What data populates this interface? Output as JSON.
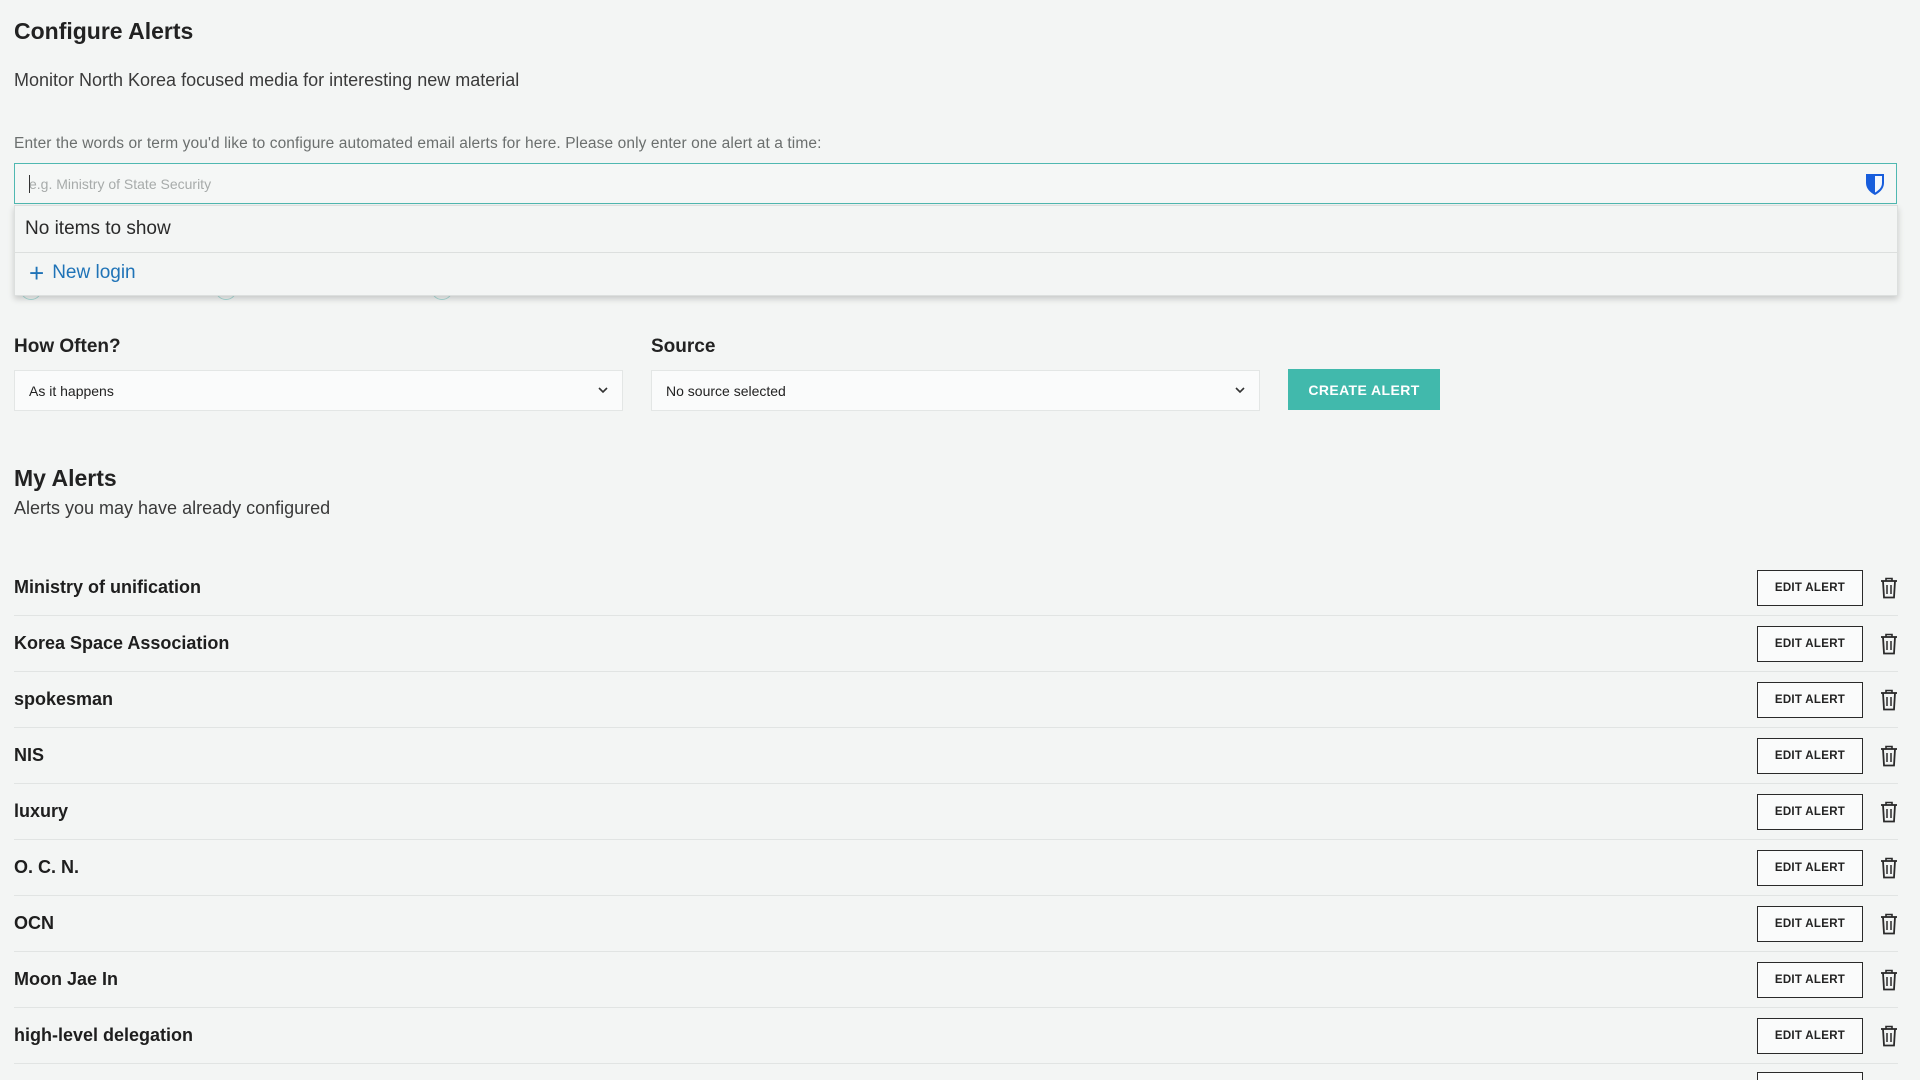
{
  "header": {
    "title": "Configure Alerts",
    "subtitle": "Monitor North Korea focused media for interesting new material"
  },
  "form": {
    "instructions": "Enter the words or term you'd like to configure automated email alerts for here. Please only enter one alert at a time:",
    "term_placeholder": "e.g. Ministry of State Security",
    "term_value": "",
    "autofill": {
      "empty_text": "No items to show",
      "new_login_label": "New login"
    },
    "frequency": {
      "label": "How Often?",
      "selected": "As it happens"
    },
    "source": {
      "label": "Source",
      "selected": "No source selected"
    },
    "create_label": "CREATE ALERT"
  },
  "my_alerts": {
    "title": "My Alerts",
    "subtitle": "Alerts you may have already configured",
    "edit_label": "EDIT ALERT",
    "items": [
      {
        "name": "Ministry of unification"
      },
      {
        "name": "Korea Space Association"
      },
      {
        "name": "spokesman"
      },
      {
        "name": "NIS"
      },
      {
        "name": "luxury"
      },
      {
        "name": "O. C. N."
      },
      {
        "name": "OCN"
      },
      {
        "name": "Moon Jae In"
      },
      {
        "name": "high-level delegation"
      }
    ]
  },
  "colors": {
    "accent": "#41b9ac",
    "link": "#1f73b7",
    "background": "#f3f5f4"
  },
  "icons": {
    "password_manager": "shield-icon",
    "dropdown": "chevron-down-icon",
    "delete": "trash-icon",
    "add": "plus-icon"
  }
}
